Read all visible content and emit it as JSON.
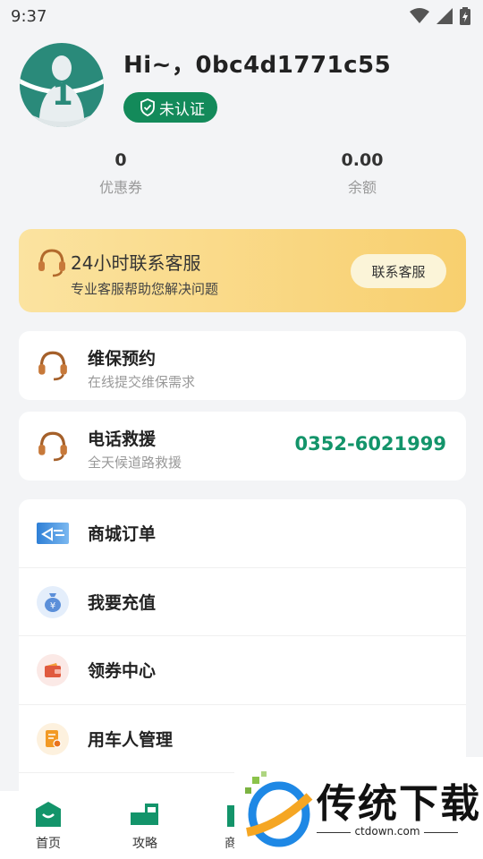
{
  "status_bar": {
    "time": "9:37",
    "icons": [
      "wifi-icon",
      "signal-icon",
      "battery-icon"
    ]
  },
  "profile": {
    "greeting": "Hi~，0bc4d1771c55",
    "verify_label": "未认证",
    "avatar_number": "1"
  },
  "stats": [
    {
      "value": "0",
      "label": "优惠券"
    },
    {
      "value": "0.00",
      "label": "余额"
    }
  ],
  "service_banner": {
    "title": "24小时联系客服",
    "subtitle": "专业客服帮助您解决问题",
    "button_label": "联系客服"
  },
  "maintenance": {
    "title": "维保预约",
    "subtitle": "在线提交维保需求"
  },
  "rescue": {
    "title": "电话救援",
    "subtitle": "全天候道路救援",
    "phone": "0352-6021999"
  },
  "menu": [
    {
      "label": "商城订单",
      "icon": "order-icon"
    },
    {
      "label": "我要充值",
      "icon": "money-bag-icon"
    },
    {
      "label": "领券中心",
      "icon": "wallet-icon"
    },
    {
      "label": "用车人管理",
      "icon": "document-icon"
    }
  ],
  "tabbar": [
    {
      "label": "首页",
      "icon": "home-icon"
    },
    {
      "label": "攻略",
      "icon": "truck-icon"
    },
    {
      "label": "商",
      "icon": "shop-icon"
    }
  ],
  "watermark": {
    "text": "传统下载",
    "url": "ctdown.com"
  },
  "colors": {
    "brand_green": "#138a5a",
    "phone_green": "#13946a",
    "banner_gold": "#f8cf6e"
  }
}
